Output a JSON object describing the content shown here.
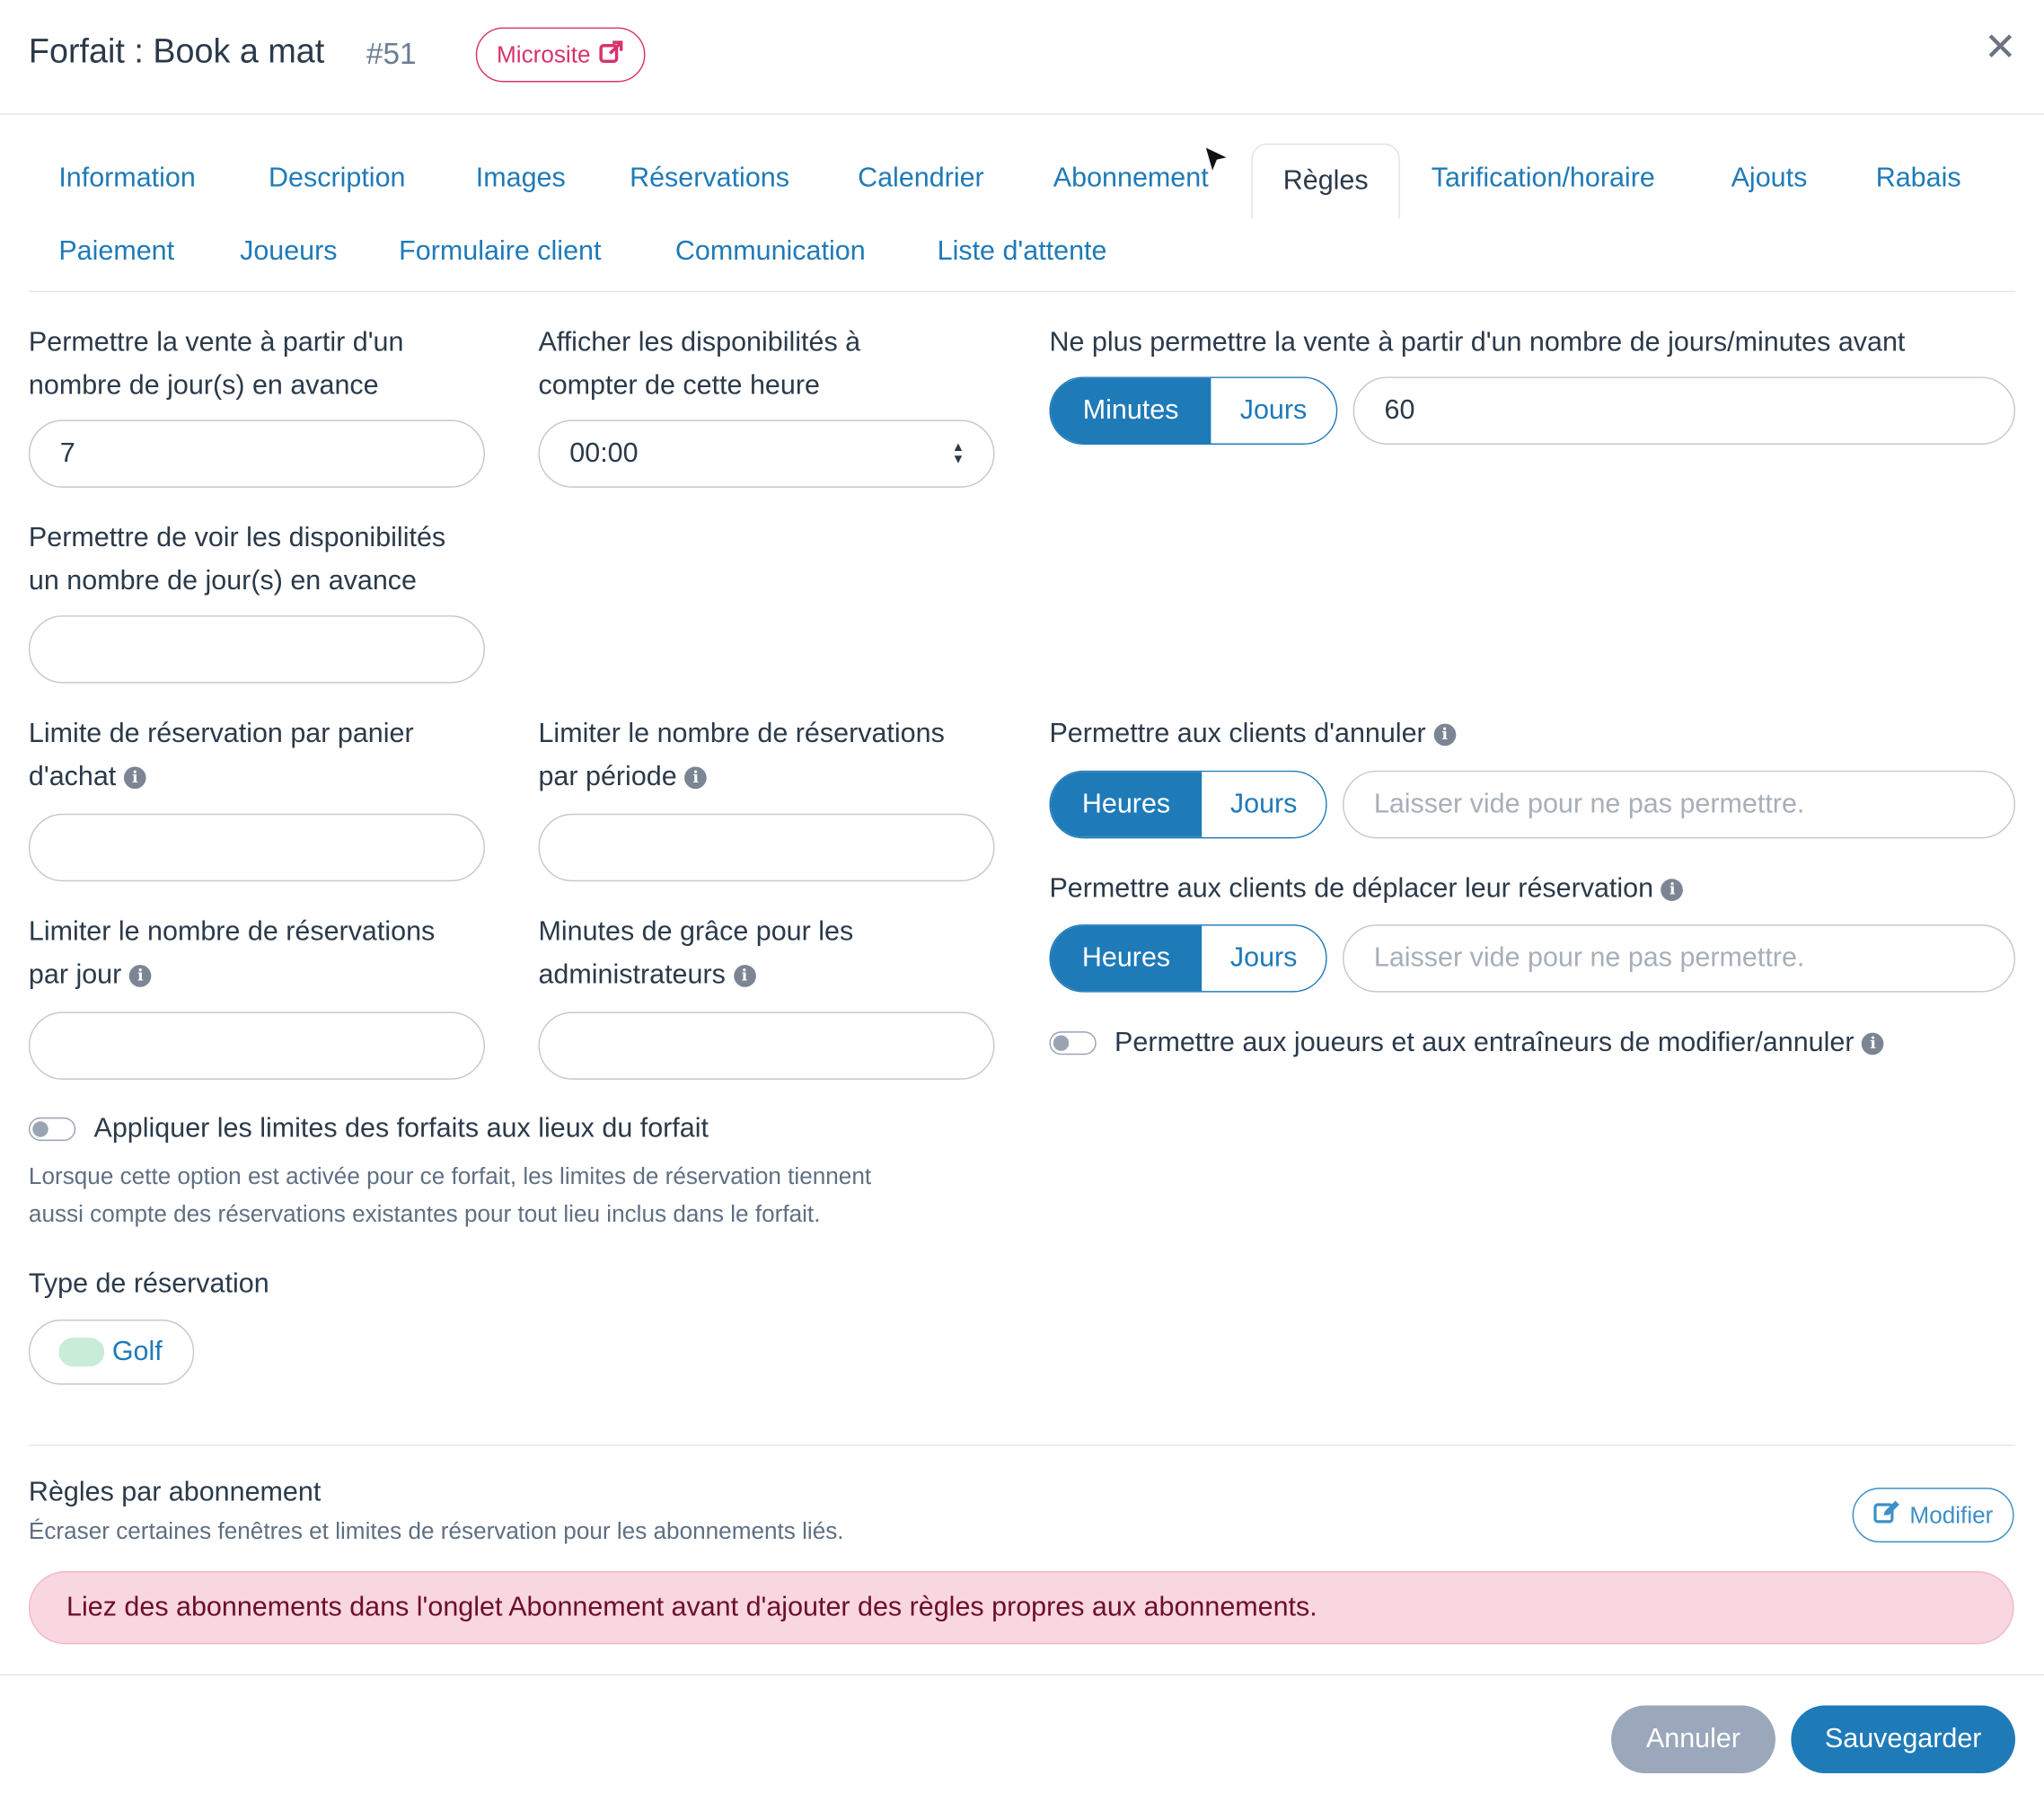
{
  "header": {
    "title": "Forfait : Book a mat",
    "id": "#51",
    "microsite_label": "Microsite",
    "close_icon": "close-icon"
  },
  "tabs": [
    {
      "label": "Information"
    },
    {
      "label": "Description"
    },
    {
      "label": "Images"
    },
    {
      "label": "Réservations"
    },
    {
      "label": "Calendrier"
    },
    {
      "label": "Abonnement"
    },
    {
      "label": "Règles",
      "active": true
    },
    {
      "label": "Tarification/horaire"
    },
    {
      "label": "Ajouts"
    },
    {
      "label": "Rabais"
    },
    {
      "label": "Paiement"
    },
    {
      "label": "Joueurs"
    },
    {
      "label": "Formulaire client"
    },
    {
      "label": "Communication"
    },
    {
      "label": "Liste d'attente"
    }
  ],
  "form": {
    "sale_days_ahead": {
      "label_line1": "Permettre la vente à partir d'un",
      "label_line2": "nombre de jour(s) en avance",
      "value": "7"
    },
    "show_availability_time": {
      "label_line1": "Afficher les disponibilités à",
      "label_line2": "compter de cette heure",
      "value": "00:00"
    },
    "stop_sale_before": {
      "label": "Ne plus permettre la vente à partir d'un nombre de jours/minutes avant",
      "unit_minutes": "Minutes",
      "unit_days": "Jours",
      "selected_unit": "Minutes",
      "value": "60"
    },
    "view_availability_days": {
      "label_line1": "Permettre de voir les disponibilités",
      "label_line2": "un nombre de jour(s) en avance",
      "value": ""
    },
    "cart_limit": {
      "label_line1": "Limite de réservation par panier",
      "label_line2": "d'achat",
      "value": ""
    },
    "period_limit": {
      "label_line1": "Limiter le nombre de réservations",
      "label_line2": "par période",
      "value": ""
    },
    "allow_cancel": {
      "label": "Permettre aux clients d'annuler",
      "unit_hours": "Heures",
      "unit_days": "Jours",
      "selected_unit": "Heures",
      "placeholder": "Laisser vide pour ne pas permettre."
    },
    "allow_move": {
      "label": "Permettre aux clients de déplacer leur réservation",
      "unit_hours": "Heures",
      "unit_days": "Jours",
      "selected_unit": "Heures",
      "placeholder": "Laisser vide pour ne pas permettre."
    },
    "day_limit": {
      "label_line1": "Limiter le nombre de réservations",
      "label_line2": "par jour",
      "value": ""
    },
    "admin_grace": {
      "label_line1": "Minutes de grâce pour les",
      "label_line2": "administrateurs",
      "value": ""
    },
    "players_modify": {
      "label": "Permettre aux joueurs et aux entraîneurs de modifier/annuler",
      "enabled": false
    },
    "apply_limits": {
      "label": "Appliquer les limites des forfaits aux lieux du forfait",
      "enabled": false,
      "help_line1": "Lorsque cette option est activée pour ce forfait, les limites de réservation tiennent",
      "help_line2": "aussi compte des réservations existantes pour tout lieu inclus dans le forfait."
    },
    "reservation_type": {
      "label": "Type de réservation",
      "chip": "Golf"
    }
  },
  "subscription_rules": {
    "title": "Règles par abonnement",
    "subtitle": "Écraser certaines fenêtres et limites de réservation pour les abonnements liés.",
    "modify_label": "Modifier",
    "alert": "Liez des abonnements dans l'onglet Abonnement avant d'ajouter des règles propres aux abonnements."
  },
  "footer": {
    "cancel_label": "Annuler",
    "save_label": "Sauvegarder"
  },
  "colors": {
    "primary": "#1f7ab8",
    "microsite": "#d6336c",
    "alert_bg": "#f8d7e0",
    "cancel_button": "#9ba7ba"
  }
}
